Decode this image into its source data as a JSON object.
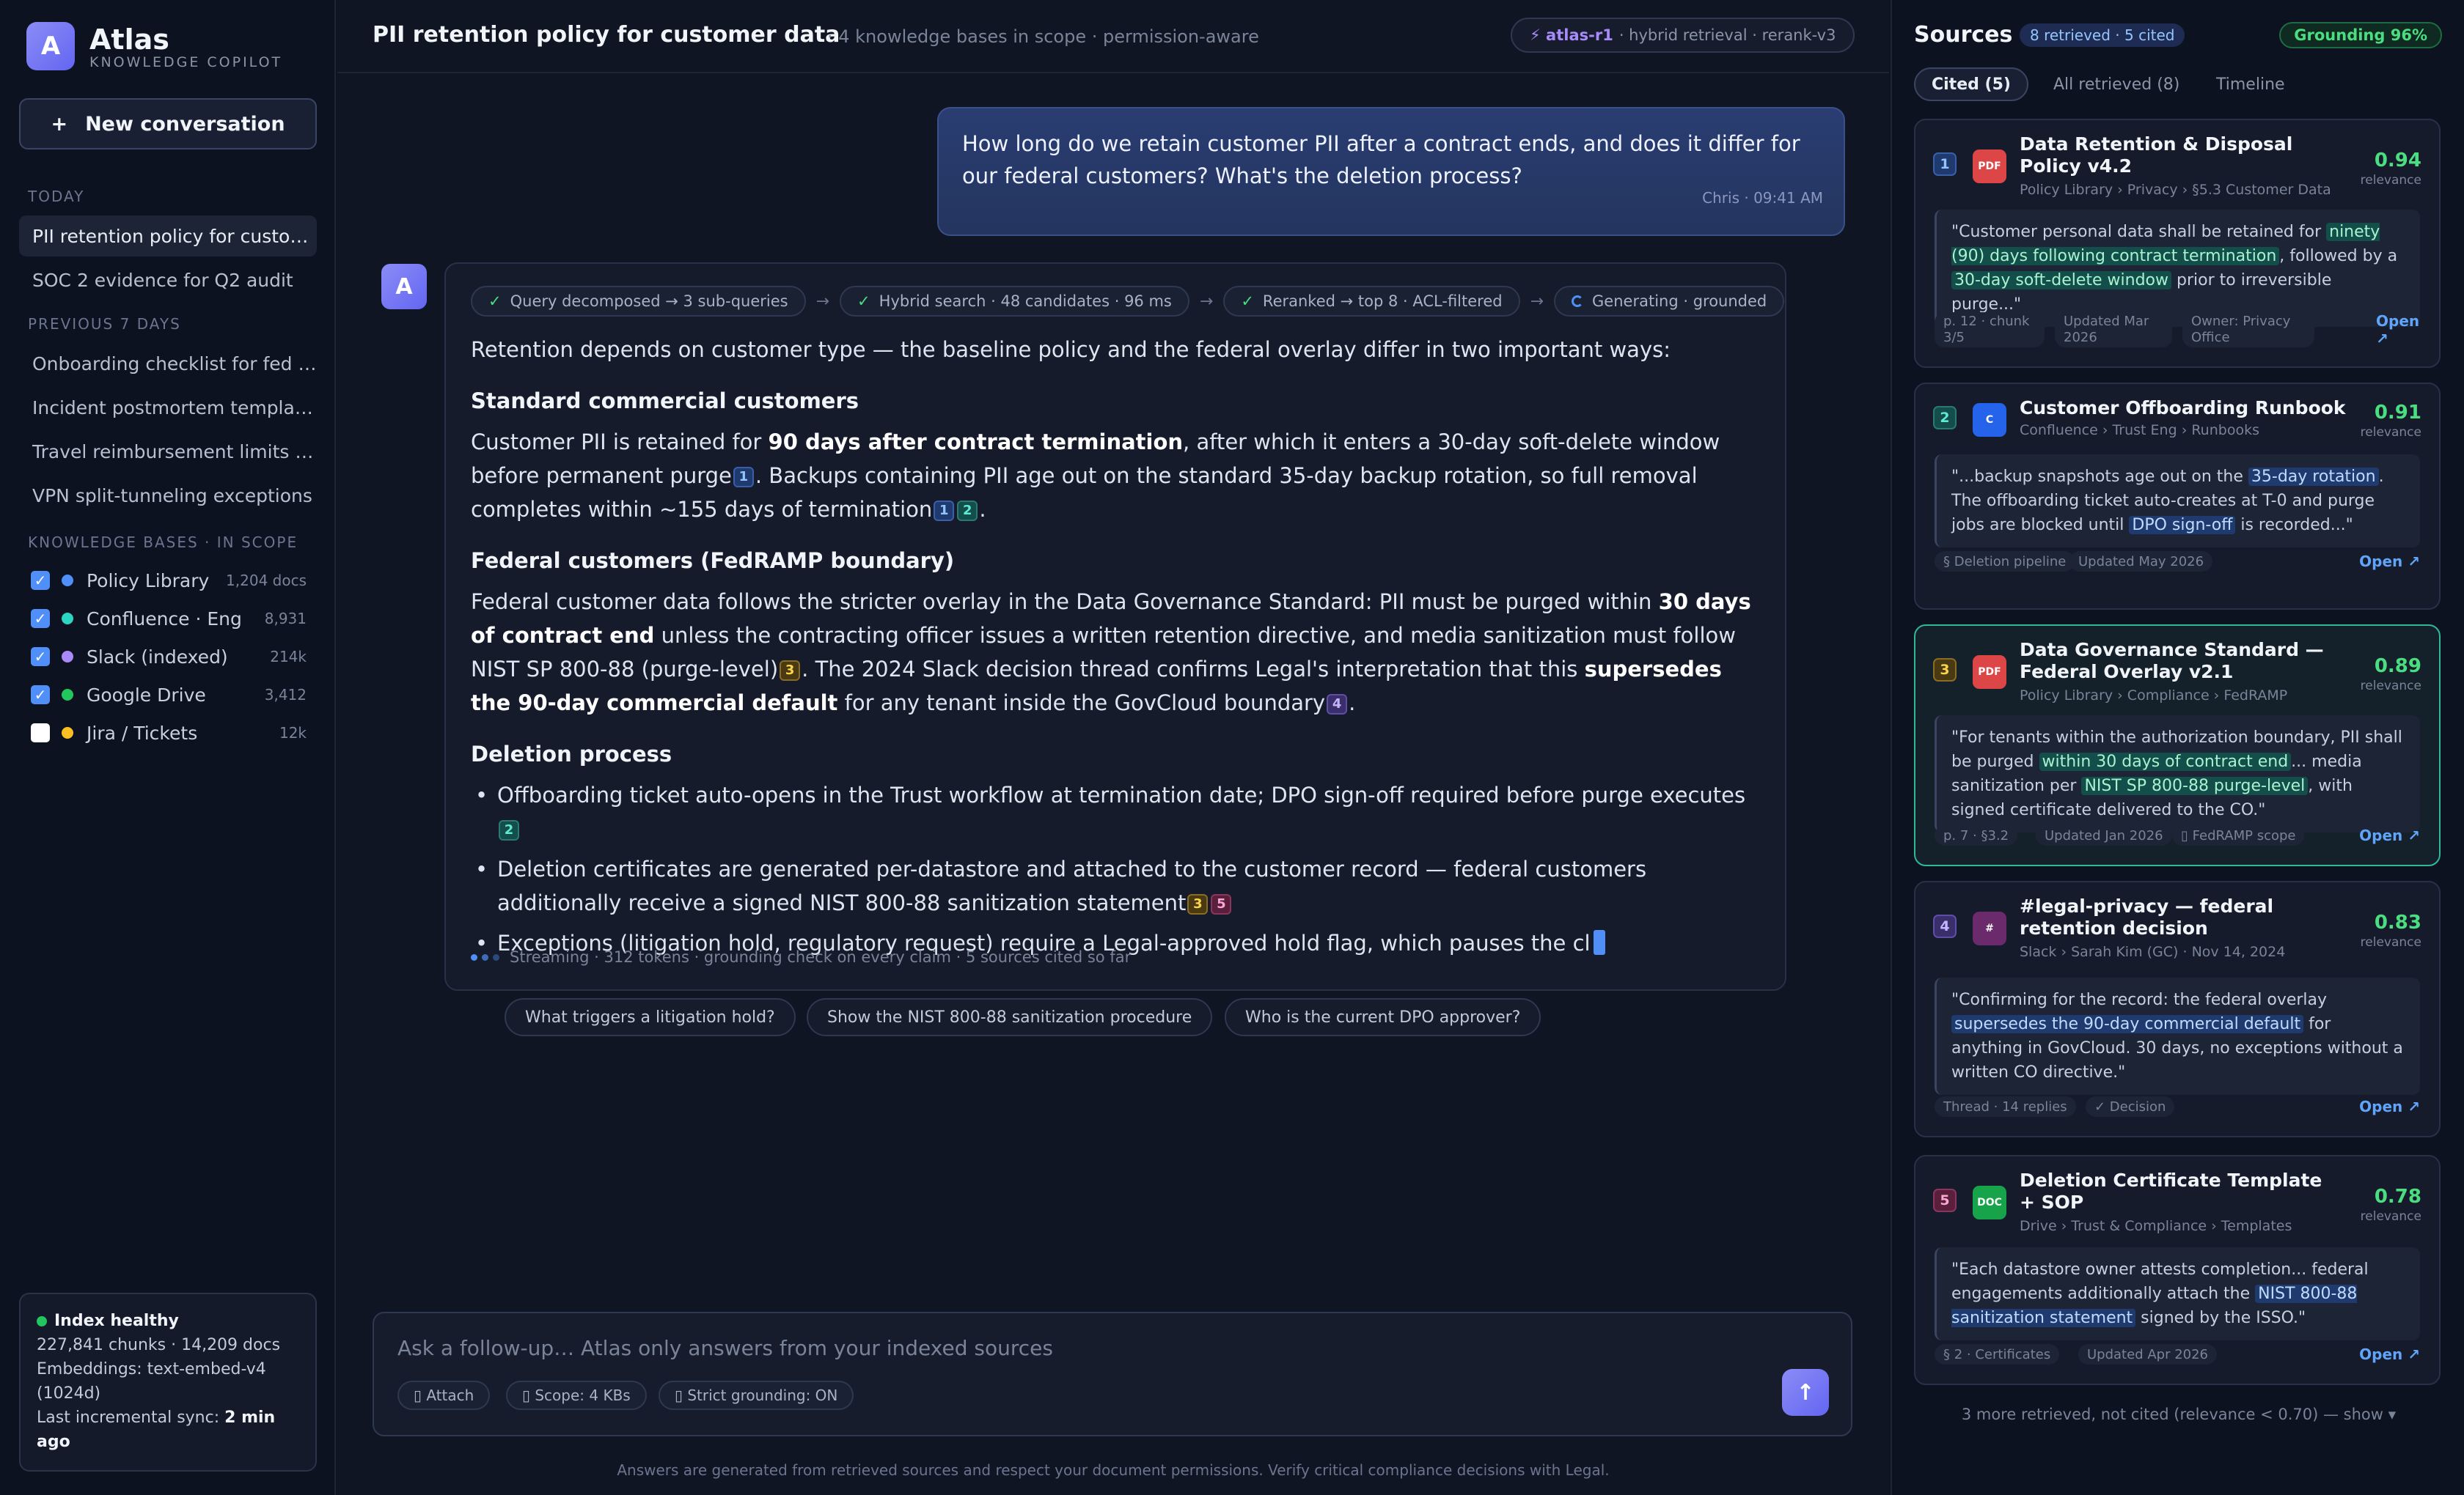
{
  "app": {
    "logo_letter": "A",
    "name": "Atlas",
    "subtitle": "KNOWLEDGE COPILOT"
  },
  "sidebar": {
    "new_conversation": "New conversation",
    "new_conversation_icon": "+",
    "today_label": "TODAY",
    "today": [
      "PII retention policy for custo…",
      "SOC 2 evidence for Q2 audit"
    ],
    "prev_label": "PREVIOUS 7 DAYS",
    "previous": [
      "Onboarding checklist for fed …",
      "Incident postmortem templa…",
      "Travel reimbursement limits …",
      "VPN split-tunneling exceptions"
    ],
    "kb_label": "KNOWLEDGE BASES · IN SCOPE",
    "kbs": [
      {
        "name": "Policy Library",
        "count": "1,204 docs",
        "checked": true,
        "color": "#4f8ff7"
      },
      {
        "name": "Confluence · Eng",
        "count": "8,931",
        "checked": true,
        "color": "#2dd4bf"
      },
      {
        "name": "Slack (indexed)",
        "count": "214k",
        "checked": true,
        "color": "#a78bfa"
      },
      {
        "name": "Google Drive",
        "count": "3,412",
        "checked": true,
        "color": "#22c55e"
      },
      {
        "name": "Jira / Tickets",
        "count": "12k",
        "checked": false,
        "color": "#fbbf24"
      }
    ],
    "health": {
      "title": "Index healthy",
      "line1": "227,841 chunks · 14,209 docs",
      "line2": "Embeddings: text-embed-v4 (1024d)",
      "sync_prefix": "Last incremental sync: ",
      "sync_value": "2 min ago"
    }
  },
  "header": {
    "title": "PII retention policy for customer data",
    "subtitle": "· 4 knowledge bases in scope · permission-aware",
    "model_name": "⚡ atlas-r1",
    "model_rest": "· hybrid retrieval · rerank-v3"
  },
  "user_message": {
    "text": "How long do we retain customer PII after a contract ends, and does it differ for our federal customers? What's the deletion process?",
    "meta": "Chris · 09:41 AM"
  },
  "assistant": {
    "avatar": "A",
    "steps": [
      {
        "icon": "✓",
        "label": "Query decomposed → 3 sub-queries"
      },
      {
        "icon": "✓",
        "label": "Hybrid search · 48 candidates · 96 ms"
      },
      {
        "icon": "✓",
        "label": "Reranked → top 8 · ACL-filtered"
      },
      {
        "icon": "",
        "label": "Generating · grounded"
      }
    ],
    "step_arrow": "→",
    "intro": "Retention depends on customer type — the baseline policy and the federal overlay differ in two important ways:",
    "h_standard": "Standard commercial customers",
    "p1_a": "Customer PII is retained for ",
    "p1_b": "90 days after contract termination",
    "p1_c": ", after which it enters a 30-day soft-delete window before permanent purge",
    "p1_d": ". Backups containing PII age out on the standard 35-day backup rotation, so full removal completes within ~155 days of termination",
    "p1_e": ".",
    "h_federal": "Federal customers (FedRAMP boundary)",
    "p2_a": "Federal customer data follows the stricter overlay in the Data Governance Standard: PII must be purged within ",
    "p2_b": "30 days of contract end",
    "p2_c": " unless the contracting officer issues a written retention directive, and media sanitization must follow NIST SP 800-88 (purge-level)",
    "p2_d": ". The 2024 Slack decision thread confirms Legal's interpretation that this ",
    "p2_e": "supersedes the 90-day commercial default",
    "p2_f": " for any tenant inside the GovCloud boundary",
    "p2_g": ".",
    "h_deletion": "Deletion process",
    "b1": "Offboarding ticket auto-opens in the Trust workflow at termination date; DPO sign-off required before purge executes",
    "b2": "Deletion certificates are generated per-datastore and attached to the customer record — federal customers additionally receive a signed NIST 800-88 sanitization statement",
    "b3": "Exceptions (litigation hold, regulatory request) require a Legal-approved hold flag, which pauses the cl",
    "cite_labels": [
      "1",
      "2",
      "3",
      "4",
      "5"
    ],
    "stream_status": "Streaming · 312 tokens · grounding check on every claim · 5 sources cited so far"
  },
  "suggestions": [
    "What triggers a litigation hold?",
    "Show the NIST 800-88 sanitization procedure",
    "Who is the current DPO approver?"
  ],
  "composer": {
    "placeholder": "Ask a follow-up… Atlas only answers from your indexed sources",
    "value": "",
    "chips": [
      "▯ Attach",
      "▯ Scope: 4 KBs",
      "▯ Strict grounding: ON"
    ],
    "send_icon": "↑"
  },
  "disclaimer": "Answers are generated from retrieved sources and respect your document permissions. Verify critical compliance decisions with Legal.",
  "sources": {
    "title": "Sources",
    "badge": "8 retrieved · 5 cited",
    "grounding": "Grounding 96%",
    "tabs": [
      "Cited (5)",
      "All retrieved (8)",
      "Timeline"
    ],
    "relevance_label": "relevance",
    "open_label": "Open ↗",
    "cards": [
      {
        "num": "1",
        "type": "PDF",
        "title": "Data Retention & Disposal Policy v4.2",
        "path": "Policy Library › Privacy › §5.3 Customer Data",
        "score": "0.94",
        "q1": "\"Customer personal data shall be retained for ",
        "m1": "ninety (90) days following contract termination",
        "q2": ", followed by a ",
        "m2": "30-day soft-delete window",
        "q3": " prior to irreversible purge...\"",
        "tags": [
          "p. 12 · chunk 3/5",
          "Updated Mar 2026",
          "Owner: Privacy Office"
        ]
      },
      {
        "num": "2",
        "type": "C",
        "title": "Customer Offboarding Runbook",
        "path": "Confluence › Trust Eng › Runbooks",
        "score": "0.91",
        "q1": "\"...backup snapshots age out on the ",
        "m1": "35-day rotation",
        "q2": ". The offboarding ticket auto-creates at T-0 and purge jobs are blocked until ",
        "m2": "DPO sign-off",
        "q3": " is recorded...\"",
        "tags": [
          "§ Deletion pipeline",
          "Updated May 2026"
        ]
      },
      {
        "num": "3",
        "type": "PDF",
        "title": "Data Governance Standard — Federal Overlay v2.1",
        "path": "Policy Library › Compliance › FedRAMP",
        "score": "0.89",
        "q1": "\"For tenants within the authorization boundary, PII shall be purged ",
        "m1": "within 30 days of contract end",
        "q2": "... media sanitization per ",
        "m2": "NIST SP 800-88 purge-level",
        "q3": ", with signed certificate delivered to the CO.\"",
        "tags": [
          "p. 7 · §3.2",
          "Updated Jan 2026",
          "▯ FedRAMP scope"
        ]
      },
      {
        "num": "4",
        "type": "#",
        "title": "#legal-privacy — federal retention decision",
        "path": "Slack › Sarah Kim (GC) · Nov 14, 2024",
        "score": "0.83",
        "q1": "\"Confirming for the record: the federal overlay ",
        "m1": "supersedes the 90-day commercial default",
        "q2": " for anything in GovCloud. 30 days, no exceptions without a written CO directive.\"",
        "m2": "",
        "q3": "",
        "tags": [
          "Thread · 14 replies",
          "✓ Decision"
        ]
      },
      {
        "num": "5",
        "type": "DOC",
        "title": "Deletion Certificate Template + SOP",
        "path": "Drive › Trust & Compliance › Templates",
        "score": "0.78",
        "q1": "\"Each datastore owner attests completion... federal engagements additionally attach the ",
        "m1": "NIST 800-88 sanitization statement",
        "q2": " signed by the ISSO.\"",
        "m2": "",
        "q3": "",
        "tags": [
          "§ 2 · Certificates",
          "Updated Apr 2026"
        ]
      }
    ],
    "more": "3 more retrieved, not cited (relevance < 0.70) — show ▾"
  }
}
